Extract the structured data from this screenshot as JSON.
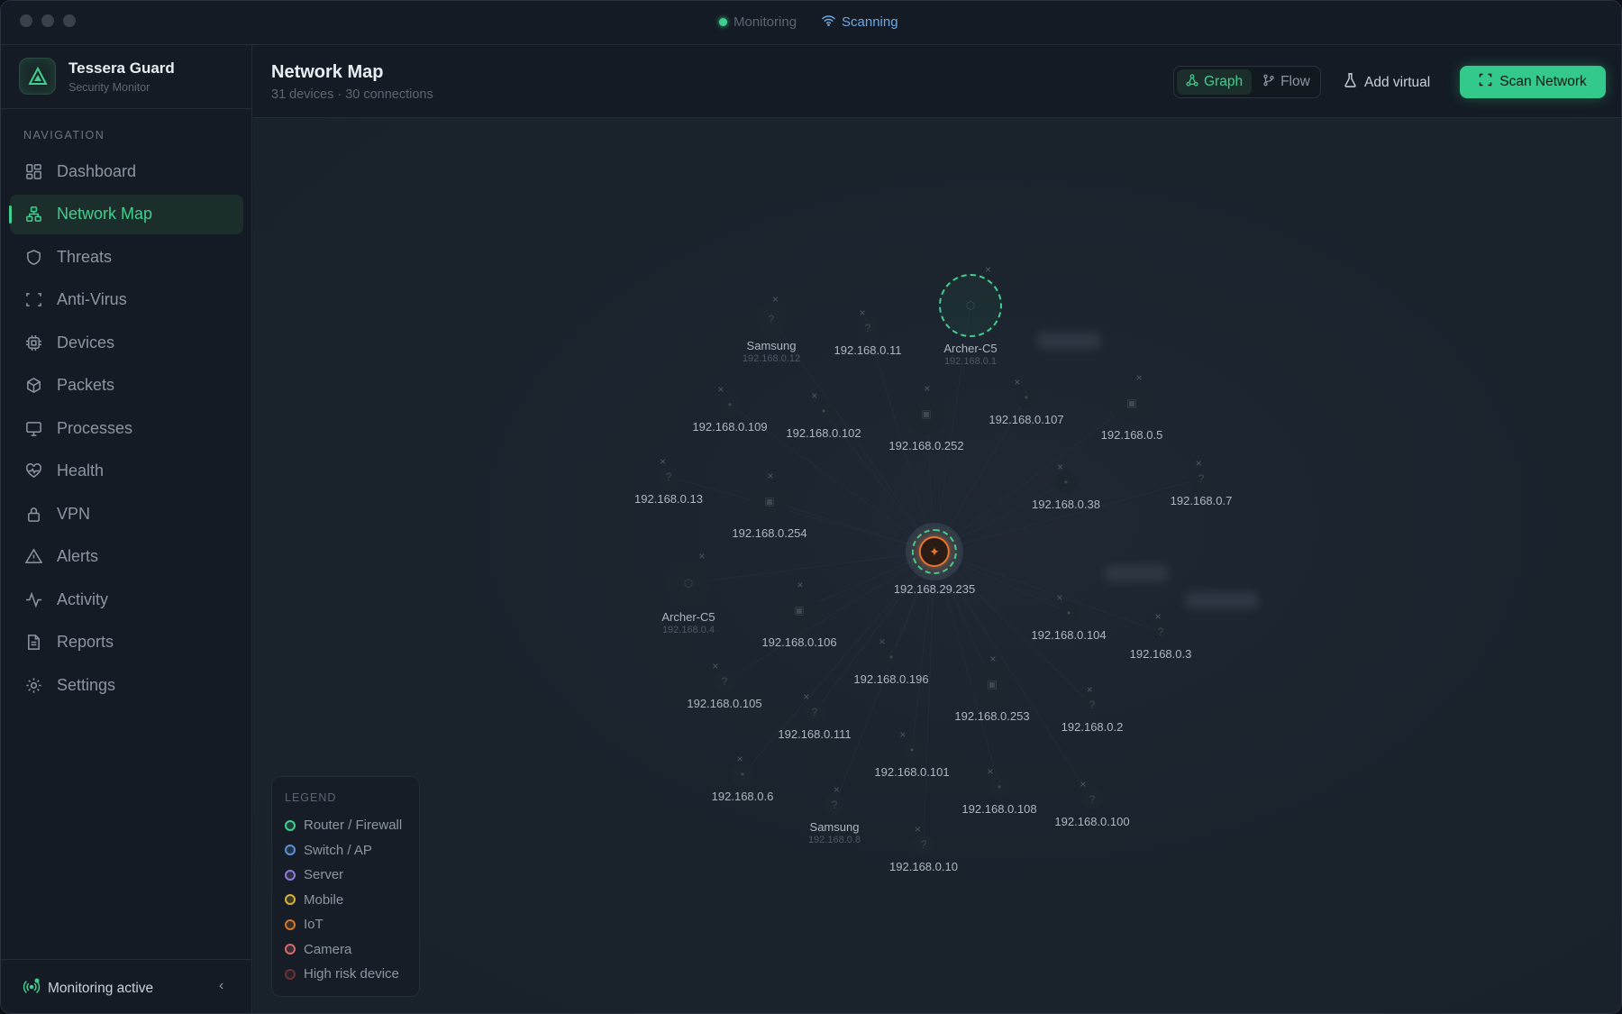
{
  "titlebar": {
    "monitoring_label": "Monitoring",
    "scanning_label": "Scanning"
  },
  "brand": {
    "name": "Tessera Guard",
    "subtitle": "Security Monitor"
  },
  "sidebar": {
    "heading": "NAVIGATION",
    "items": [
      {
        "label": "Dashboard",
        "icon": "dashboard-icon",
        "active": false
      },
      {
        "label": "Network Map",
        "icon": "network-icon",
        "active": true
      },
      {
        "label": "Threats",
        "icon": "shield-icon",
        "active": false
      },
      {
        "label": "Anti-Virus",
        "icon": "scan-icon",
        "active": false
      },
      {
        "label": "Devices",
        "icon": "chip-icon",
        "active": false
      },
      {
        "label": "Packets",
        "icon": "package-icon",
        "active": false
      },
      {
        "label": "Processes",
        "icon": "monitor-icon",
        "active": false
      },
      {
        "label": "Health",
        "icon": "heart-pulse-icon",
        "active": false
      },
      {
        "label": "VPN",
        "icon": "lock-icon",
        "active": false
      },
      {
        "label": "Alerts",
        "icon": "alert-triangle-icon",
        "active": false
      },
      {
        "label": "Activity",
        "icon": "activity-icon",
        "active": false
      },
      {
        "label": "Reports",
        "icon": "file-icon",
        "active": false
      },
      {
        "label": "Settings",
        "icon": "gear-icon",
        "active": false
      }
    ],
    "footer_status": "Monitoring active"
  },
  "header": {
    "title": "Network Map",
    "subtitle": "31 devices · 30 connections",
    "view_graph": "Graph",
    "view_flow": "Flow",
    "add_virtual": "Add virtual",
    "scan_button": "Scan Network"
  },
  "map": {
    "center": {
      "label": "192.168.29.235"
    },
    "nodes": [
      {
        "label": "Samsung",
        "ip": "192.168.0.12",
        "glyph": "?"
      },
      {
        "label": "192.168.0.11",
        "glyph": "?"
      },
      {
        "label": "Archer-C5",
        "ip": "192.168.0.1",
        "glyph": "⬡"
      },
      {
        "label": "192.168.0.109",
        "glyph": "•"
      },
      {
        "label": "192.168.0.102",
        "glyph": "•"
      },
      {
        "label": "192.168.0.252",
        "glyph": "▣"
      },
      {
        "label": "192.168.0.107",
        "glyph": "•"
      },
      {
        "label": "192.168.0.5",
        "glyph": "▣"
      },
      {
        "label": "192.168.0.13",
        "glyph": "?"
      },
      {
        "label": "192.168.0.254",
        "glyph": "▣"
      },
      {
        "label": "192.168.0.38",
        "glyph": "•"
      },
      {
        "label": "192.168.0.7",
        "glyph": "?"
      },
      {
        "label": "Archer-C5",
        "ip": "192.168.0.4",
        "glyph": "⬡"
      },
      {
        "label": "192.168.0.106",
        "glyph": "▣"
      },
      {
        "label": "192.168.0.104",
        "glyph": "•"
      },
      {
        "label": "192.168.0.3",
        "glyph": "?"
      },
      {
        "label": "192.168.0.196",
        "glyph": "•"
      },
      {
        "label": "192.168.0.253",
        "glyph": "▣"
      },
      {
        "label": "192.168.0.105",
        "glyph": "?"
      },
      {
        "label": "192.168.0.111",
        "glyph": "?"
      },
      {
        "label": "192.168.0.2",
        "glyph": "?"
      },
      {
        "label": "192.168.0.101",
        "glyph": "•"
      },
      {
        "label": "192.168.0.6",
        "glyph": "•"
      },
      {
        "label": "Samsung",
        "ip": "192.168.0.8",
        "glyph": "?"
      },
      {
        "label": "192.168.0.108",
        "glyph": "•"
      },
      {
        "label": "192.168.0.100",
        "glyph": "?"
      },
      {
        "label": "192.168.0.10",
        "glyph": "?"
      }
    ]
  },
  "legend": {
    "title": "LEGEND",
    "items": [
      {
        "label": "Router / Firewall",
        "color": "#3fcf8e"
      },
      {
        "label": "Switch / AP",
        "color": "#5b8fd6"
      },
      {
        "label": "Server",
        "color": "#8f7ad6"
      },
      {
        "label": "Mobile",
        "color": "#d6b23a"
      },
      {
        "label": "IoT",
        "color": "#d6762e"
      },
      {
        "label": "Camera",
        "color": "#d66a6a"
      },
      {
        "label": "High risk device",
        "color": "#6b3434"
      }
    ]
  },
  "colors": {
    "accent": "#3fcf8e",
    "scanning": "#6fa8e3",
    "center_node": "#e8742e"
  }
}
